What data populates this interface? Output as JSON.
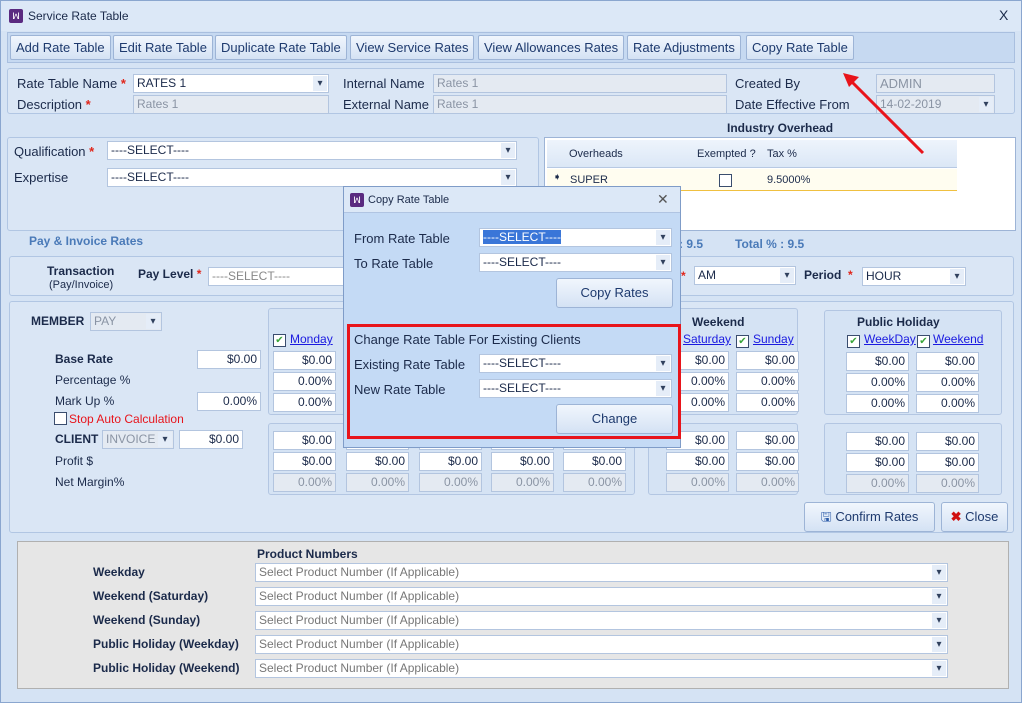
{
  "window": {
    "title": "Service Rate Table",
    "close": "X"
  },
  "toolbar": [
    "Add Rate Table",
    "Edit Rate Table",
    "Duplicate Rate Table",
    "View Service Rates",
    "View Allowances Rates",
    "Rate Adjustments",
    "Copy Rate Table"
  ],
  "header": {
    "rate_table_name_label": "Rate Table Name",
    "rate_table_name": "RATES 1",
    "description_label": "Description",
    "description": "Rates 1",
    "internal_name_label": "Internal Name",
    "internal_name": "Rates 1",
    "external_name_label": "External Name",
    "external_name": "Rates 1",
    "created_by_label": "Created By",
    "created_by": "ADMIN",
    "date_effective_label": "Date Effective From",
    "date_effective": "14-02-2019"
  },
  "qualification": {
    "label": "Qualification",
    "value": "----SELECT----"
  },
  "expertise": {
    "label": "Expertise",
    "value": "----SELECT----"
  },
  "overhead": {
    "title": "Industry Overhead",
    "columns": [
      "Overheads",
      "Exempted ?",
      "Tax %"
    ],
    "row": {
      "name": "SUPER",
      "tax": "9.5000%"
    },
    "partial_total": ": 9.5",
    "total": "Total % : 9.5"
  },
  "pay_invoice": {
    "title": "Pay & Invoice Rates",
    "transaction": "Transaction",
    "transaction_sub": "(Pay/Invoice)",
    "pay_level_label": "Pay Level",
    "pay_level": "----SELECT----",
    "ampm": "AM",
    "period_label": "Period",
    "period": "HOUR"
  },
  "member": {
    "label": "MEMBER",
    "type": "PAY",
    "base_rate_label": "Base Rate",
    "base_rate": "$0.00",
    "percentage_label": "Percentage %",
    "markup_label": "Mark Up %",
    "markup": "0.00%",
    "stop_auto": "Stop Auto Calculation",
    "client_label": "CLIENT",
    "client_type": "INVOICE",
    "client_value": "$0.00",
    "profit_label": "Profit $",
    "net_margin_label": "Net Margin%"
  },
  "days": {
    "monday": "Monday",
    "weekend": "Weekend",
    "saturday": "Saturday",
    "sunday": "Sunday",
    "public_holiday": "Public Holiday",
    "ph_weekday": "WeekDay",
    "ph_weekend": "Weekend"
  },
  "cells": {
    "money": "$0.00",
    "pct": "0.00%"
  },
  "buttons": {
    "confirm": "Confirm Rates",
    "close": "Close"
  },
  "products": {
    "title": "Product Numbers",
    "placeholder": "Select Product Number (If Applicable)",
    "rows": [
      "Weekday",
      "Weekend (Saturday)",
      "Weekend (Sunday)",
      "Public Holiday (Weekday)",
      "Public Holiday (Weekend)"
    ]
  },
  "dialog": {
    "title": "Copy Rate Table",
    "from_label": "From Rate Table",
    "from": "----SELECT----",
    "to_label": "To Rate Table",
    "to": "----SELECT----",
    "copy": "Copy Rates",
    "section": "Change Rate Table For Existing Clients",
    "existing_label": "Existing Rate Table",
    "existing": "----SELECT----",
    "new_label": "New Rate Table",
    "new": "----SELECT----",
    "change": "Change"
  },
  "colors": {
    "highlight": "#e8141b",
    "accent": "#1a1ae0"
  }
}
